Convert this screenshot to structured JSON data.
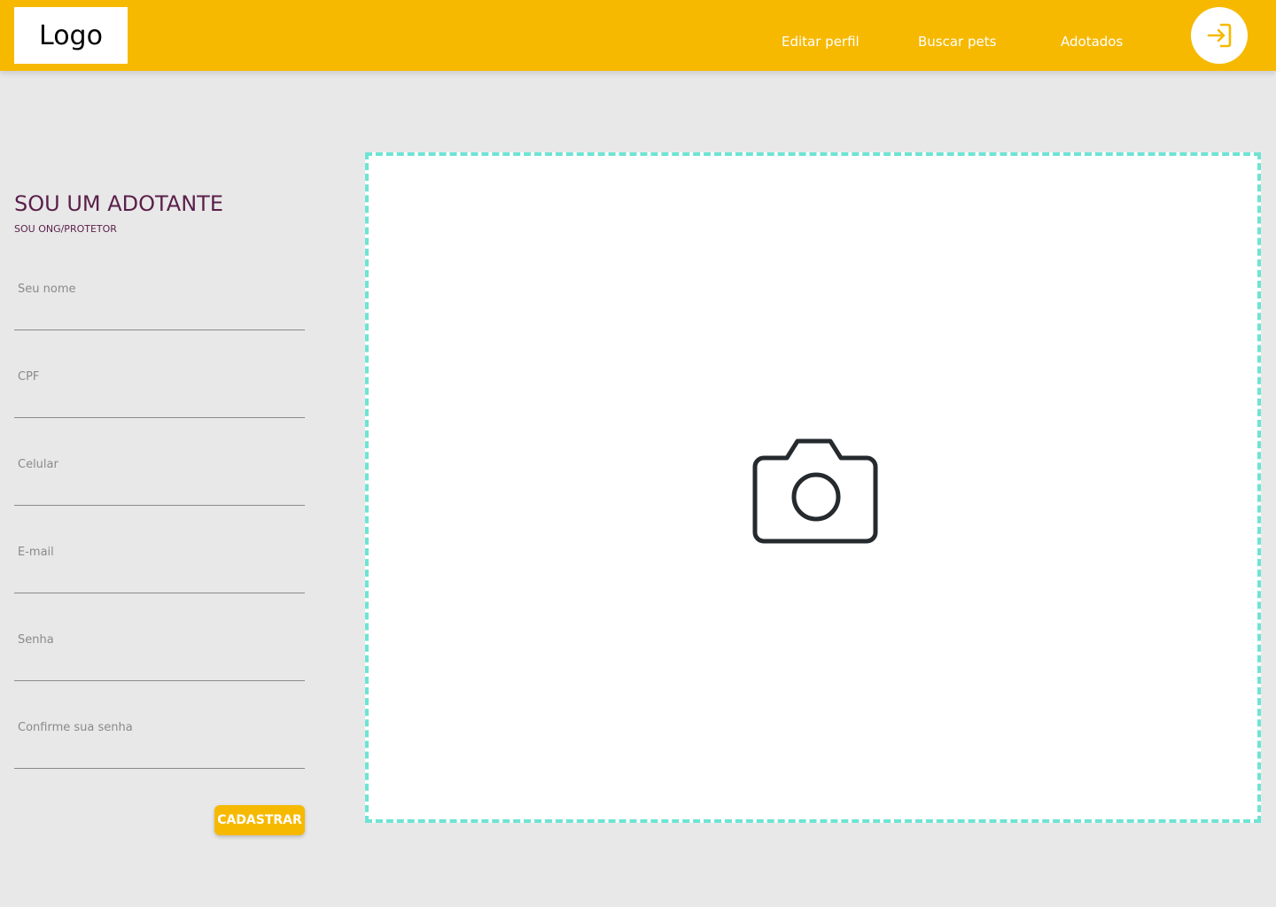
{
  "header": {
    "logo": "Logo",
    "nav": {
      "edit_profile": "Editar perfil",
      "search_pets": "Buscar pets",
      "adopted": "Adotados"
    },
    "login_icon": "login-arrow-icon"
  },
  "form": {
    "title": "SOU UM ADOTANTE",
    "subtitle": "SOU ONG/PROTETOR",
    "fields": [
      {
        "label": "Seu nome",
        "value": ""
      },
      {
        "label": "CPF",
        "value": ""
      },
      {
        "label": "Celular",
        "value": ""
      },
      {
        "label": "E-mail",
        "value": ""
      },
      {
        "label": "Senha",
        "value": ""
      },
      {
        "label": "Confirme sua senha",
        "value": ""
      }
    ],
    "submit_label": "CADASTRAR"
  },
  "upload": {
    "icon": "camera-icon"
  },
  "colors": {
    "header_bg": "#f6b900",
    "title": "#5b1f4a",
    "dropzone_border": "#6ee4d3",
    "background": "#e8e8e8"
  }
}
